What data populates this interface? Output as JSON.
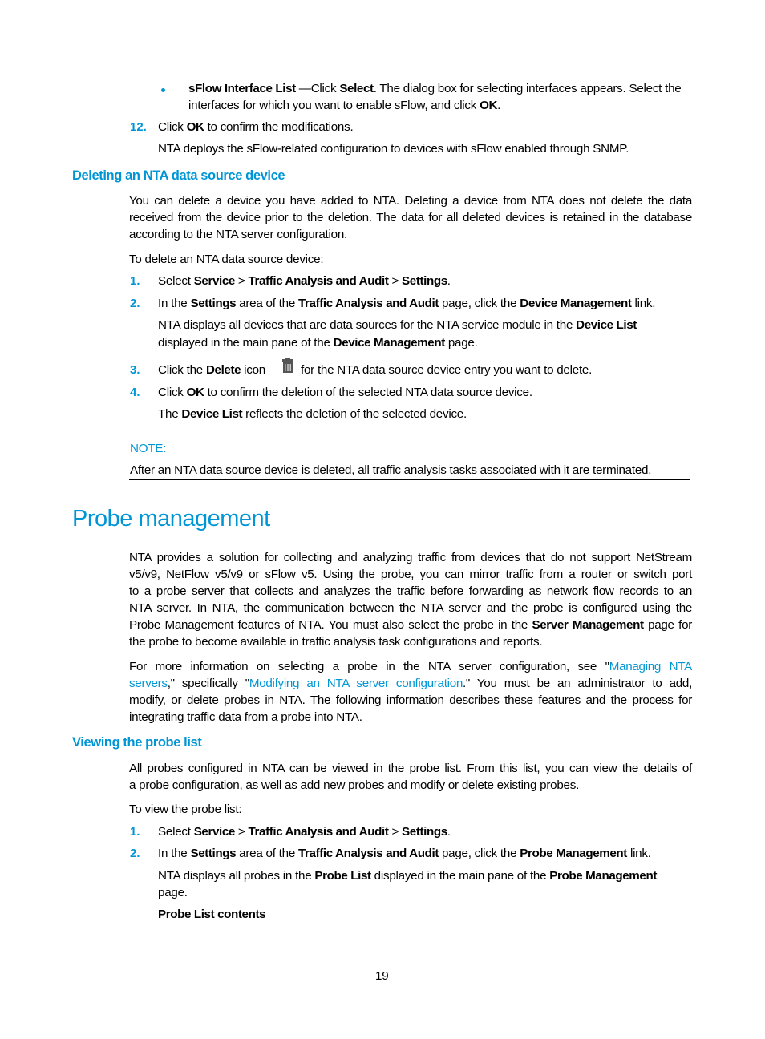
{
  "page_number": "19",
  "top_bullet": {
    "term": "sFlow Interface List",
    "pre": " —Click ",
    "select": "Select",
    "rest1": ". The dialog box for selecting interfaces appears. Select the",
    "line2_pre": "interfaces for which you want to enable sFlow, and click ",
    "ok": "OK",
    "line2_post": "."
  },
  "step12": {
    "number": "12.",
    "pre": "Click ",
    "ok": "OK",
    "post": " to confirm the modifications.",
    "note": "NTA deploys the sFlow-related configuration to devices with sFlow enabled through SNMP."
  },
  "section_delete": {
    "heading": "Deleting an NTA data source device",
    "intro_lines": [
      "You can delete a device you have added to NTA. Deleting a device from NTA does not delete the data",
      "received from the device prior to the deletion. The data for all deleted devices is retained in the database",
      "according to the NTA server configuration."
    ],
    "lead": "To delete an NTA data source device:",
    "steps": [
      {
        "number": "1.",
        "parts": [
          "Select ",
          "Service",
          " > ",
          "Traffic Analysis and Audit",
          " > ",
          "Settings",
          "."
        ]
      },
      {
        "number": "2.",
        "parts": [
          "In the ",
          "Settings",
          " area of the ",
          "Traffic Analysis and Audit",
          " page, click the ",
          "Device Management",
          " link."
        ],
        "detail1": [
          "NTA displays all devices that are data sources for the NTA service module in the ",
          "Device List"
        ],
        "detail2": [
          "displayed in the main pane of the ",
          "Device Management",
          " page."
        ]
      },
      {
        "number": "3.",
        "parts": [
          "Click the ",
          "Delete",
          " icon ",
          "for the NTA data source device entry you want to delete."
        ],
        "icon": "trash-icon"
      },
      {
        "number": "4.",
        "parts": [
          "Click ",
          "OK",
          " to confirm the deletion of the selected NTA data source device."
        ],
        "detail": [
          "The ",
          "Device List",
          " reflects the deletion of the selected device."
        ]
      }
    ],
    "note_label": "NOTE:",
    "note_text": "After an NTA data source device is deleted, all traffic analysis tasks associated with it are terminated."
  },
  "section_probe": {
    "title": "Probe management",
    "para1_lines": [
      "NTA provides a solution for collecting and analyzing traffic from devices that do not support NetStream",
      "v5/v9, NetFlow v5/v9 or sFlow v5. Using the probe, you can mirror traffic from a router or switch port",
      "to a probe server that collects and analyzes the traffic before forwarding as network flow records to an",
      "NTA server. In NTA, the communication between the NTA server and the probe is configured using the"
    ],
    "para1_line5": [
      "Probe Management features of NTA. You must also select the probe in the ",
      "Server Management",
      " page for"
    ],
    "para1_line6": "the probe to become available in traffic analysis task configurations and reports.",
    "para2_line1_pre": "For more information on selecting a probe in the NTA server configuration, see \"",
    "para2_link1a": "Managing NTA",
    "para2_link1b": "servers",
    "para2_line2_mid": ",\" specifically \"",
    "para2_link2": "Modifying an NTA server configuration",
    "para2_line2_post": ".\" You must be an administrator to add,",
    "para2_line3": "modify, or delete probes in NTA. The following information describes these features and the process for",
    "para2_line4": "integrating traffic data from a probe into NTA."
  },
  "section_view": {
    "heading": "Viewing the probe list",
    "intro_lines": [
      "All probes configured in NTA can be viewed in the probe list. From this list, you can view the details of",
      "a probe configuration, as well as add new probes and modify or delete existing probes."
    ],
    "lead": "To view the probe list:",
    "steps": [
      {
        "number": "1.",
        "parts": [
          "Select ",
          "Service",
          " > ",
          "Traffic Analysis and Audit",
          " > ",
          "Settings",
          "."
        ]
      },
      {
        "number": "2.",
        "parts": [
          "In the ",
          "Settings",
          " area of the ",
          "Traffic Analysis and Audit",
          " page, click the ",
          "Probe Management",
          " link."
        ],
        "detail1": [
          "NTA displays all probes in the ",
          "Probe List",
          " displayed in the main pane of the ",
          "Probe Management"
        ],
        "detail2": "page."
      }
    ],
    "table_caption": "Probe List contents"
  },
  "colors": {
    "accent": "#0096d6",
    "text": "#000000"
  }
}
